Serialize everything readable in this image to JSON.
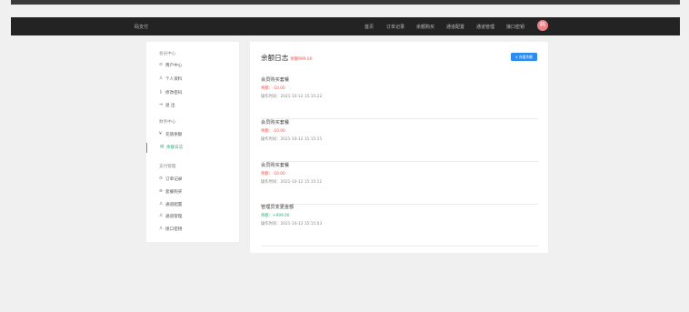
{
  "navbar": {
    "brand": "码支付",
    "links": [
      "首页",
      "订单记录",
      "余额购买",
      "通道配置",
      "通道管理",
      "接口密钥"
    ],
    "avatar_text": "码"
  },
  "sidebar": {
    "groups": [
      {
        "title": "会员中心",
        "items": [
          {
            "icon": "user-circle-icon",
            "glyph": "⊙",
            "label": "用户中心"
          },
          {
            "icon": "user-icon",
            "glyph": "♙",
            "label": "个人资料"
          },
          {
            "icon": "key-icon",
            "glyph": "⚷",
            "label": "修改密码"
          },
          {
            "icon": "logout-icon",
            "glyph": "⇥",
            "label": "退 出"
          }
        ]
      },
      {
        "title": "财务中心",
        "items": [
          {
            "icon": "yen-icon",
            "glyph": "¥",
            "label": "充值余额"
          },
          {
            "icon": "list-icon",
            "glyph": "▤",
            "label": "余额日志",
            "active": true
          }
        ]
      },
      {
        "title": "支付管理",
        "items": [
          {
            "icon": "order-icon",
            "glyph": "⊙",
            "label": "订单记录"
          },
          {
            "icon": "buy-icon",
            "glyph": "⊖",
            "label": "套餐购买"
          },
          {
            "icon": "channel-config-icon",
            "glyph": "♙",
            "label": "通道配置"
          },
          {
            "icon": "channel-manage-icon",
            "glyph": "♙",
            "label": "通道管理"
          },
          {
            "icon": "api-key-icon",
            "glyph": "♙",
            "label": "接口密钥"
          }
        ]
      }
    ]
  },
  "main": {
    "title": "余额日志",
    "balance_note": "余额999.00",
    "recharge_button": "¥ 充值余额",
    "entries": [
      {
        "title": "会员购买套餐",
        "amount": "余额：-10.00",
        "time": "操作时间：2021-10-12 15:15:22",
        "positive": false
      },
      {
        "title": "会员购买套餐",
        "amount": "余额：-10.00",
        "time": "操作时间：2021-10-12 15:15:15",
        "positive": false
      },
      {
        "title": "会员购买套餐",
        "amount": "余额：-10.00",
        "time": "操作时间：2021-10-12 15:15:12",
        "positive": false
      },
      {
        "title": "管理员变更金额",
        "amount": "余额：+999.00",
        "time": "操作时间：2021-10-12 15:15:03",
        "positive": true
      }
    ]
  },
  "colors": {
    "accent_green": "#31b07b",
    "negative_red": "#f0524b",
    "button_blue": "#2d8cf0",
    "navbar_bg": "#232323"
  }
}
